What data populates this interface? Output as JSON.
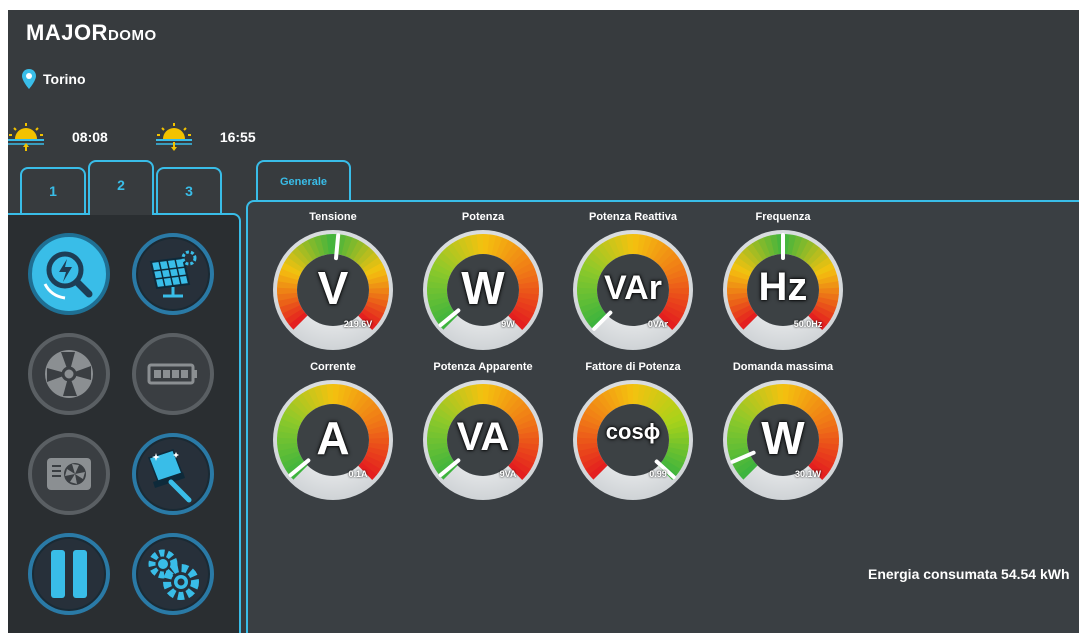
{
  "header": {
    "logo_main": "MAJOR",
    "logo_sub": "DOMO",
    "city": "Torino",
    "sunrise": "08:08",
    "sunset": "16:55"
  },
  "left_tabs": [
    {
      "label": "1",
      "active": false
    },
    {
      "label": "2",
      "active": true
    },
    {
      "label": "3",
      "active": false
    }
  ],
  "icons": [
    {
      "name": "energy-monitor-icon",
      "state": "active"
    },
    {
      "name": "solar-panel-icon",
      "state": "on"
    },
    {
      "name": "fan-icon",
      "state": "off"
    },
    {
      "name": "battery-icon",
      "state": "off"
    },
    {
      "name": "air-conditioner-icon",
      "state": "off"
    },
    {
      "name": "window-cleaner-icon",
      "state": "on"
    },
    {
      "name": "pause-icon",
      "state": "on"
    },
    {
      "name": "settings-gears-icon",
      "state": "on"
    }
  ],
  "right_tab": "Generale",
  "gauges": [
    {
      "title": "Tensione",
      "symbol": "V",
      "value": "219.6V",
      "needle_fraction": 0.52
    },
    {
      "title": "Potenza",
      "symbol": "W",
      "value": "9W",
      "needle_fraction": 0.02
    },
    {
      "title": "Potenza Reattiva",
      "symbol": "VAr",
      "value": "0VAr",
      "needle_fraction": 0.0
    },
    {
      "title": "Frequenza",
      "symbol": "Hz",
      "value": "50.0Hz",
      "needle_fraction": 0.5
    },
    {
      "title": "Corrente",
      "symbol": "A",
      "value": "0.1A",
      "needle_fraction": 0.02
    },
    {
      "title": "Potenza Apparente",
      "symbol": "VA",
      "value": "9VA",
      "needle_fraction": 0.02
    },
    {
      "title": "Fattore di Potenza",
      "symbol": "cosϕ",
      "value": "0.99",
      "needle_fraction": 0.99
    },
    {
      "title": "Domanda massima",
      "symbol": "W",
      "value": "30.1W",
      "needle_fraction": 0.08
    }
  ],
  "energy": {
    "label": "Energia consumata",
    "value": "54.54",
    "unit": "kWh"
  },
  "colors": {
    "accent": "#39bde8",
    "background": "#373b3e",
    "panel": "#3a3f43"
  }
}
